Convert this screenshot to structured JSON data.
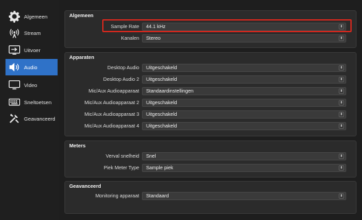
{
  "sidebar": {
    "items": [
      {
        "label": "Algemeen",
        "icon": "gear-icon"
      },
      {
        "label": "Stream",
        "icon": "broadcast-icon"
      },
      {
        "label": "Uitvoer",
        "icon": "output-icon"
      },
      {
        "label": "Audio",
        "icon": "speaker-icon"
      },
      {
        "label": "Video",
        "icon": "monitor-icon"
      },
      {
        "label": "Sneltoetsen",
        "icon": "keyboard-icon"
      },
      {
        "label": "Geavanceerd",
        "icon": "tools-icon"
      }
    ],
    "active_index": 3
  },
  "groups": {
    "algemeen": {
      "title": "Algemeen",
      "rows": [
        {
          "label": "Sample Rate",
          "value": "44.1 kHz"
        },
        {
          "label": "Kanalen",
          "value": "Stereo"
        }
      ]
    },
    "apparaten": {
      "title": "Apparaten",
      "rows": [
        {
          "label": "Desktop Audio",
          "value": "Uitgeschakeld"
        },
        {
          "label": "Desktop Audio 2",
          "value": "Uitgeschakeld"
        },
        {
          "label": "Mic/Aux Audioapparaat",
          "value": "Standaardinstellingen"
        },
        {
          "label": "Mic/Aux Audioapparaat 2",
          "value": "Uitgeschakeld"
        },
        {
          "label": "Mic/Aux Audioapparaat 3",
          "value": "Uitgeschakeld"
        },
        {
          "label": "Mic/Aux Audioapparaat 4",
          "value": "Uitgeschakeld"
        }
      ]
    },
    "meters": {
      "title": "Meters",
      "rows": [
        {
          "label": "Verval snelheid",
          "value": "Snel"
        },
        {
          "label": "Piek Meter Type",
          "value": "Sample piek"
        }
      ]
    },
    "geavanceerd": {
      "title": "Geavanceerd",
      "rows": [
        {
          "label": "Monitoring apparaat",
          "value": "Standaard"
        }
      ]
    }
  },
  "colors": {
    "accent": "#2f72c8",
    "highlight": "#d0281e",
    "panel": "#2b2b2b",
    "background": "#1e1e1e"
  }
}
